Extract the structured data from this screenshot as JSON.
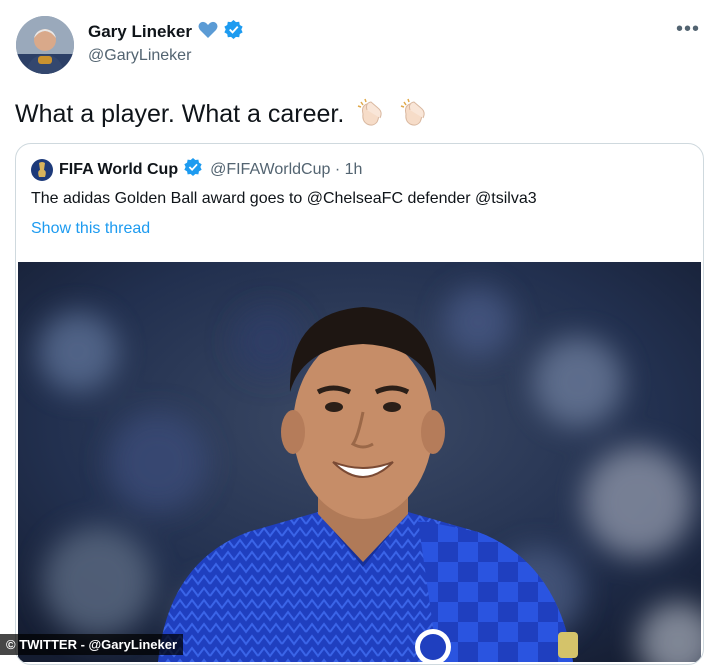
{
  "author": {
    "name": "Gary Lineker",
    "handle": "@GaryLineker"
  },
  "tweet": {
    "text": "What a player. What a career.",
    "emoji": [
      "clapping-hands",
      "clapping-hands"
    ]
  },
  "quoted": {
    "name": "FIFA World Cup",
    "handle": "@FIFAWorldCup · 1h",
    "text": "The adidas Golden Ball award goes to @ChelseaFC defender @tsilva3",
    "show_thread": "Show this thread"
  },
  "credit": "© TWITTER - @GaryLineker",
  "colors": {
    "verified": "#1d9bf0",
    "link": "#1d9bf0",
    "heart": "#5b9bd5",
    "jersey": "#1f3fbf"
  },
  "icons": [
    "verified-badge-icon",
    "blue-heart-icon",
    "more-options-icon",
    "clap-emoji-icon"
  ]
}
